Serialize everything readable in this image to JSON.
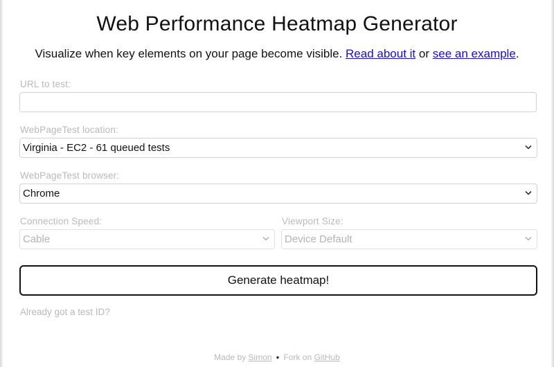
{
  "title": "Web Performance Heatmap Generator",
  "intro": {
    "text": "Visualize when key elements on your page become visible.",
    "read_link": "Read about it",
    "or_text": "or",
    "example_link": "see an example",
    "end_punct": "."
  },
  "url_field": {
    "label": "URL to test:",
    "value": "",
    "placeholder": ""
  },
  "location_field": {
    "label": "WebPageTest location:",
    "selected": "Virginia - EC2 - 61 queued tests"
  },
  "browser_field": {
    "label": "WebPageTest browser:",
    "selected": "Chrome"
  },
  "speed_field": {
    "label": "Connection Speed:",
    "selected": "Cable",
    "disabled": true
  },
  "viewport_field": {
    "label": "Viewport Size:",
    "selected": "Device Default",
    "disabled": true
  },
  "generate_button": {
    "label": "Generate heatmap!"
  },
  "already_link": {
    "label": "Already got a test ID?"
  },
  "footer": {
    "made_by": "Made by",
    "author_link": "Simon",
    "separator": "•",
    "fork_text": "Fork on",
    "github_link": "GitHub"
  },
  "colors": {
    "link": "#1a0dcc",
    "muted_text": "#b9b9b9",
    "border": "#d2d2d2",
    "button_border": "#111111"
  },
  "icons": {
    "select_chevron": "chevron-down-icon"
  }
}
